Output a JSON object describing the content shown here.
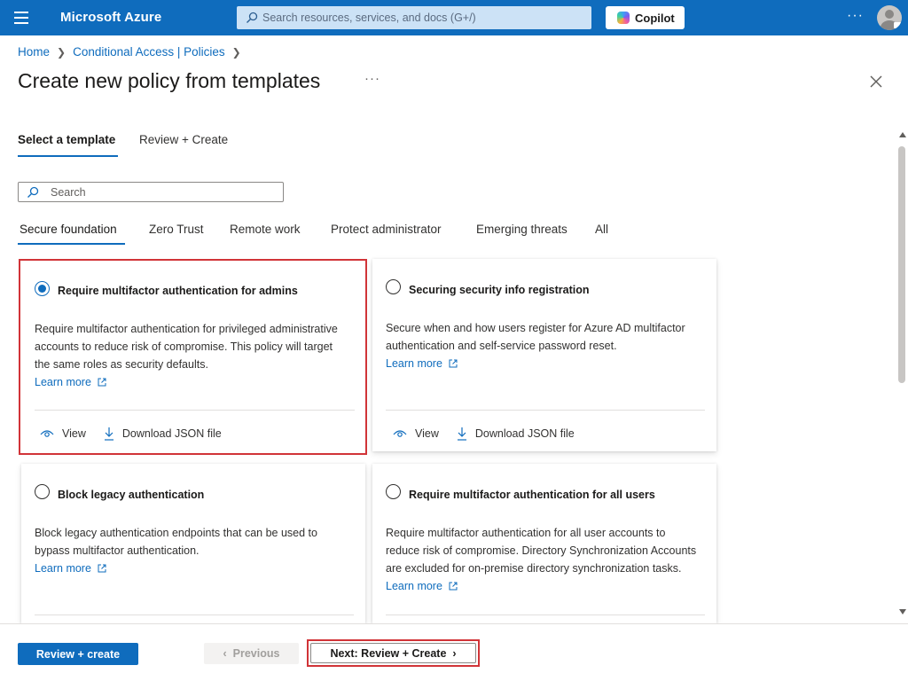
{
  "topbar": {
    "brand": "Microsoft Azure",
    "search_placeholder": "Search resources, services, and docs (G+/)",
    "copilot_label": "Copilot",
    "more": "···",
    "color": "#0f6cbd"
  },
  "breadcrumb": [
    {
      "label": "Home"
    },
    {
      "label": "Conditional Access | Policies"
    }
  ],
  "page": {
    "title": "Create new policy from templates",
    "more": "···"
  },
  "steps": [
    {
      "label": "Select a template",
      "active": true
    },
    {
      "label": "Review + Create",
      "active": false
    }
  ],
  "template_search": {
    "placeholder": "Search"
  },
  "categories": [
    {
      "label": "Secure foundation",
      "active": true
    },
    {
      "label": "Zero Trust"
    },
    {
      "label": "Remote work"
    },
    {
      "label": "Protect administrator"
    },
    {
      "label": "Emerging threats"
    },
    {
      "label": "All"
    }
  ],
  "cards": [
    {
      "title": "Require multifactor authentication for admins",
      "description": "Require multifactor authentication for privileged administrative accounts to reduce risk of compromise. This policy will target the same roles as security defaults.",
      "learn_more": "Learn more",
      "view": "View",
      "download": "Download JSON file",
      "selected": true
    },
    {
      "title": "Securing security info registration",
      "description": "Secure when and how users register for Azure AD multifactor authentication and self-service password reset.",
      "learn_more": "Learn more",
      "view": "View",
      "download": "Download JSON file",
      "selected": false
    },
    {
      "title": "Block legacy authentication",
      "description": "Block legacy authentication endpoints that can be used to bypass multifactor authentication.",
      "learn_more": "Learn more",
      "selected": false
    },
    {
      "title": "Require multifactor authentication for all users",
      "description": "Require multifactor authentication for all user accounts to reduce risk of compromise. Directory Synchronization Accounts are excluded for on-premise directory synchronization tasks.",
      "learn_more": "Learn more",
      "selected": false
    }
  ],
  "footer": {
    "review_create": "Review + create",
    "previous": "Previous",
    "next": "Next: Review + Create"
  },
  "colors": {
    "accent": "#0f6cbd",
    "highlight": "#d13438"
  }
}
